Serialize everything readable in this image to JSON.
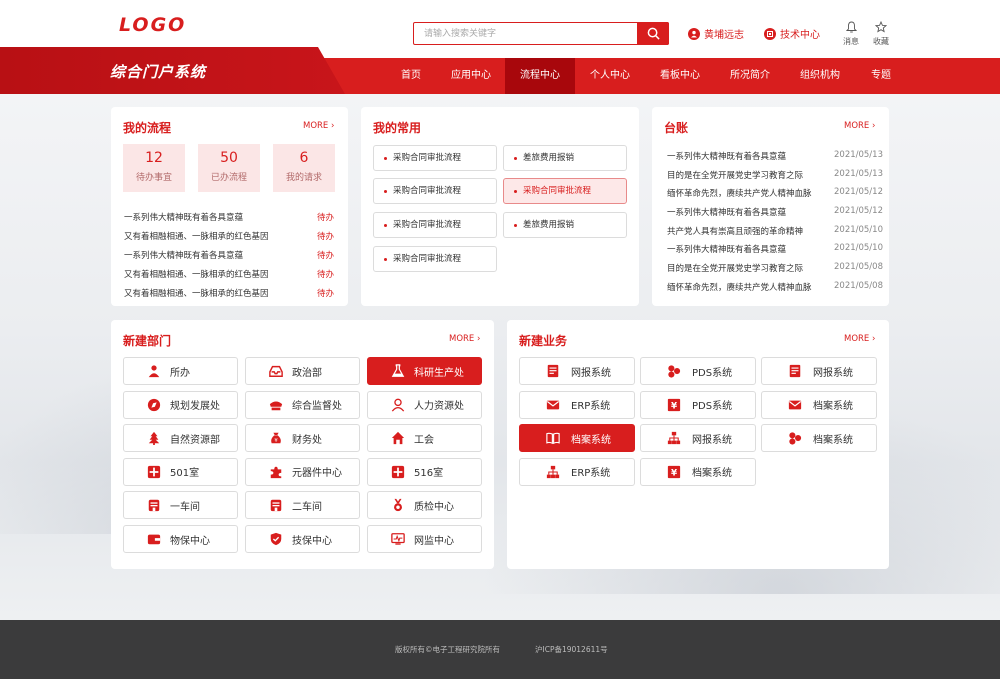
{
  "header": {
    "logo": "LOGO",
    "search_placeholder": "请输入搜索关键字",
    "user_name": "黄埔远志",
    "tech_center": "技术中心",
    "messages": "消息",
    "favorites": "收藏"
  },
  "brand": {
    "system_name": "综合门户系统"
  },
  "nav": {
    "items": [
      "首页",
      "应用中心",
      "流程中心",
      "个人中心",
      "看板中心",
      "所况简介",
      "组织机构",
      "专题"
    ],
    "active_index": 2
  },
  "my_flow": {
    "title": "我的流程",
    "more": "MORE",
    "stats": [
      {
        "num": "12",
        "label": "待办事宜"
      },
      {
        "num": "50",
        "label": "已办流程"
      },
      {
        "num": "6",
        "label": "我的请求"
      }
    ],
    "rows": [
      {
        "text": "一系列伟大精神既有着各具意蕴",
        "status": "待办"
      },
      {
        "text": "又有着相融相通、一脉相承的红色基因",
        "status": "待办"
      },
      {
        "text": "一系列伟大精神既有着各具意蕴",
        "status": "待办"
      },
      {
        "text": "又有着相融相通、一脉相承的红色基因",
        "status": "待办"
      },
      {
        "text": "又有着相融相通、一脉相承的红色基因",
        "status": "待办"
      }
    ]
  },
  "my_common": {
    "title": "我的常用",
    "items": [
      "采购合同审批流程",
      "差旅费用报销",
      "采购合同审批流程",
      "采购合同审批流程",
      "采购合同审批流程",
      "差旅费用报销",
      "采购合同审批流程"
    ],
    "active_index": 3
  },
  "ledger": {
    "title": "台账",
    "more": "MORE",
    "rows": [
      {
        "text": "一系列伟大精神既有着各具意蕴",
        "date": "2021/05/13"
      },
      {
        "text": "目的是在全党开展党史学习教育之际",
        "date": "2021/05/13"
      },
      {
        "text": "缅怀革命先烈，赓续共产党人精神血脉",
        "date": "2021/05/12"
      },
      {
        "text": "一系列伟大精神既有着各具意蕴",
        "date": "2021/05/12"
      },
      {
        "text": "共产党人具有崇高且顽强的革命精神",
        "date": "2021/05/10"
      },
      {
        "text": "一系列伟大精神既有着各具意蕴",
        "date": "2021/05/10"
      },
      {
        "text": "目的是在全党开展党史学习教育之际",
        "date": "2021/05/08"
      },
      {
        "text": "缅怀革命先烈，赓续共产党人精神血脉",
        "date": "2021/05/08"
      }
    ]
  },
  "departments": {
    "title": "新建部门",
    "more": "MORE",
    "items": [
      {
        "label": "所办",
        "icon": "person-icon"
      },
      {
        "label": "政治部",
        "icon": "inbox-icon"
      },
      {
        "label": "科研生产处",
        "icon": "flask-icon"
      },
      {
        "label": "规划发展处",
        "icon": "compass-icon"
      },
      {
        "label": "综合监督处",
        "icon": "police-cap-icon"
      },
      {
        "label": "人力资源处",
        "icon": "user-icon"
      },
      {
        "label": "自然资源部",
        "icon": "tree-icon"
      },
      {
        "label": "财务处",
        "icon": "money-bag-icon"
      },
      {
        "label": "工会",
        "icon": "home-icon"
      },
      {
        "label": "501室",
        "icon": "cross-icon"
      },
      {
        "label": "元器件中心",
        "icon": "puzzle-icon"
      },
      {
        "label": "516室",
        "icon": "cross-icon"
      },
      {
        "label": "一车间",
        "icon": "building-icon"
      },
      {
        "label": "二车间",
        "icon": "building-icon"
      },
      {
        "label": "质检中心",
        "icon": "medal-icon"
      },
      {
        "label": "物保中心",
        "icon": "wallet-icon"
      },
      {
        "label": "技保中心",
        "icon": "shield-check-icon"
      },
      {
        "label": "网监中心",
        "icon": "monitor-icon"
      }
    ],
    "active_index": 2
  },
  "business": {
    "title": "新建业务",
    "more": "MORE",
    "items": [
      {
        "label": "网报系统",
        "icon": "document-icon"
      },
      {
        "label": "PDS系统",
        "icon": "circles-icon"
      },
      {
        "label": "网报系统",
        "icon": "document-icon"
      },
      {
        "label": "ERP系统",
        "icon": "mail-icon"
      },
      {
        "label": "PDS系统",
        "icon": "yen-icon"
      },
      {
        "label": "档案系统",
        "icon": "mail-icon"
      },
      {
        "label": "档案系统",
        "icon": "book-icon"
      },
      {
        "label": "网报系统",
        "icon": "org-chart-icon"
      },
      {
        "label": "档案系统",
        "icon": "circles-icon"
      },
      {
        "label": "ERP系统",
        "icon": "org-chart-icon"
      },
      {
        "label": "档案系统",
        "icon": "yen-icon"
      }
    ],
    "active_index": 6
  },
  "footer": {
    "copyright": "版权所有©电子工程研究院所有",
    "icp": "沪ICP备19012611号"
  },
  "colors": {
    "primary": "#d81e1e",
    "nav_active": "#a8070c",
    "footer": "#3b3b3c"
  }
}
